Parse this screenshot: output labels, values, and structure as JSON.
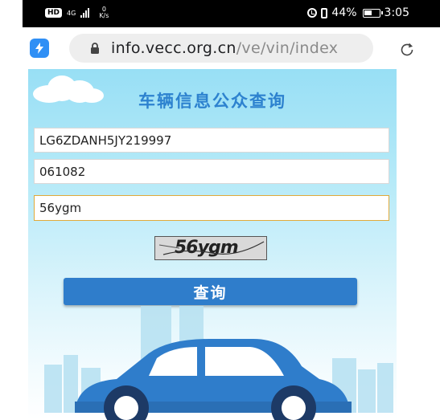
{
  "status_bar": {
    "hd_badge": "HD",
    "network_type": "4G",
    "speed_value": "0",
    "speed_unit": "K/s",
    "battery_percent": "44%",
    "time": "3:05"
  },
  "browser": {
    "url_host": "info.vecc.org.cn",
    "url_path": "/ve/vin/index"
  },
  "page": {
    "title": "车辆信息公众查询",
    "vin_value": "LG6ZDANH5JY219997",
    "code_value": "061082",
    "captcha_value": "56ygm",
    "captcha_image_text": "56ygm",
    "query_button_label": "查询"
  },
  "colors": {
    "title": "#2d82cf",
    "button": "#2f7dcb",
    "car_body": "#2f7dcb",
    "sky_top": "#98dff5"
  }
}
